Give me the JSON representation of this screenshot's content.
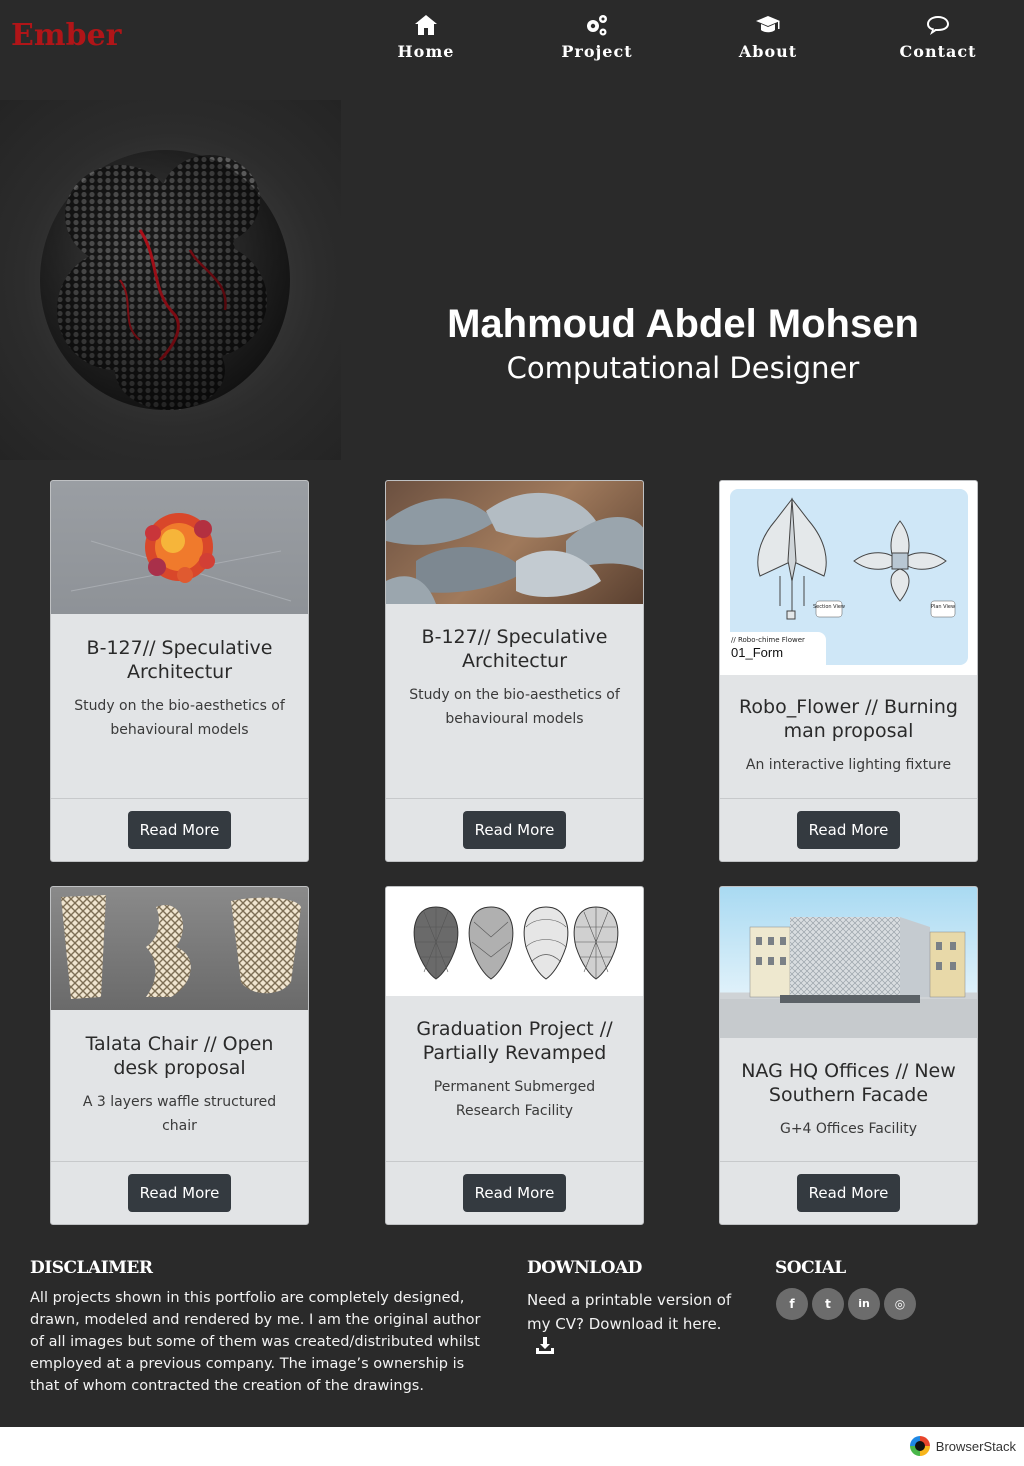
{
  "nav": {
    "brand": "Ember",
    "items": [
      {
        "label": "Home",
        "icon": "home-icon"
      },
      {
        "label": "Project",
        "icon": "gears-icon"
      },
      {
        "label": "About",
        "icon": "graduation-cap-icon"
      },
      {
        "label": "Contact",
        "icon": "speech-bubble-icon"
      }
    ]
  },
  "hero": {
    "name": "Mahmoud Abdel Mohsen",
    "role": "Computational Designer"
  },
  "cards": [
    {
      "title": "B-127// Speculative Architectur",
      "description": "Study on the bio-aesthetics of behavioural models",
      "button": "Read More"
    },
    {
      "title": "B-127// Speculative Architectur",
      "description": "Study on the bio-aesthetics of behavioural models",
      "button": "Read More"
    },
    {
      "title": "Robo_Flower // Burning man proposal",
      "description": "An interactive lighting fixture",
      "button": "Read More",
      "image_labels": {
        "series": "// Robo-chime Flower",
        "form": "01_Form",
        "section": "Section View",
        "plan": "Plan View"
      }
    },
    {
      "title": "Talata Chair // Open desk proposal",
      "description": "A 3 layers waffle structured chair",
      "button": "Read More"
    },
    {
      "title": "Graduation Project // Partially Revamped",
      "description": "Permanent Submerged Research Facility",
      "button": "Read More"
    },
    {
      "title": "NAG HQ Offices // New Southern Facade",
      "description": "G+4 Offices Facility",
      "button": "Read More"
    }
  ],
  "footer": {
    "disclaimer_title": "DISCLAIMER",
    "disclaimer_text": "All projects shown in this portfolio are completely designed, drawn, modeled and rendered by me. I am the original author of all images but some of them was created/distributed whilst employed at a previous company. The image’s ownership is that of whom contracted the creation of the drawings.",
    "download_title": "DOWNLOAD",
    "download_text": "Need a printable version of my CV? Download it here.",
    "social_title": "SOCIAL",
    "social": [
      {
        "glyph": "f",
        "icon": "facebook-icon"
      },
      {
        "glyph": "t",
        "icon": "twitter-icon"
      },
      {
        "glyph": "in",
        "icon": "linkedin-icon"
      },
      {
        "glyph": "◎",
        "icon": "instagram-icon"
      }
    ]
  },
  "watermark": "BrowserStack"
}
